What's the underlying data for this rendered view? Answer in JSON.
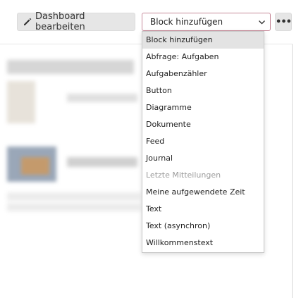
{
  "toolbar": {
    "edit_label": "Dashboard bearbeiten",
    "add_block_selected": "Block hinzufügen"
  },
  "menu": {
    "items": [
      {
        "label": "Block hinzufügen",
        "state": "selected"
      },
      {
        "label": "Abfrage: Aufgaben",
        "state": "normal"
      },
      {
        "label": "Aufgabenzähler",
        "state": "normal"
      },
      {
        "label": "Button",
        "state": "normal"
      },
      {
        "label": "Diagramme",
        "state": "normal"
      },
      {
        "label": "Dokumente",
        "state": "normal"
      },
      {
        "label": "Feed",
        "state": "normal"
      },
      {
        "label": "Journal",
        "state": "normal"
      },
      {
        "label": "Letzte Mitteilungen",
        "state": "disabled"
      },
      {
        "label": "Meine aufgewendete Zeit",
        "state": "normal"
      },
      {
        "label": "Text",
        "state": "normal"
      },
      {
        "label": "Text (asynchron)",
        "state": "normal"
      },
      {
        "label": "Willkommenstext",
        "state": "normal"
      }
    ]
  },
  "colors": {
    "select_border": "#c78a9a",
    "selected_item_bg": "#e3e3e3",
    "disabled_text": "#9a9a9a"
  }
}
